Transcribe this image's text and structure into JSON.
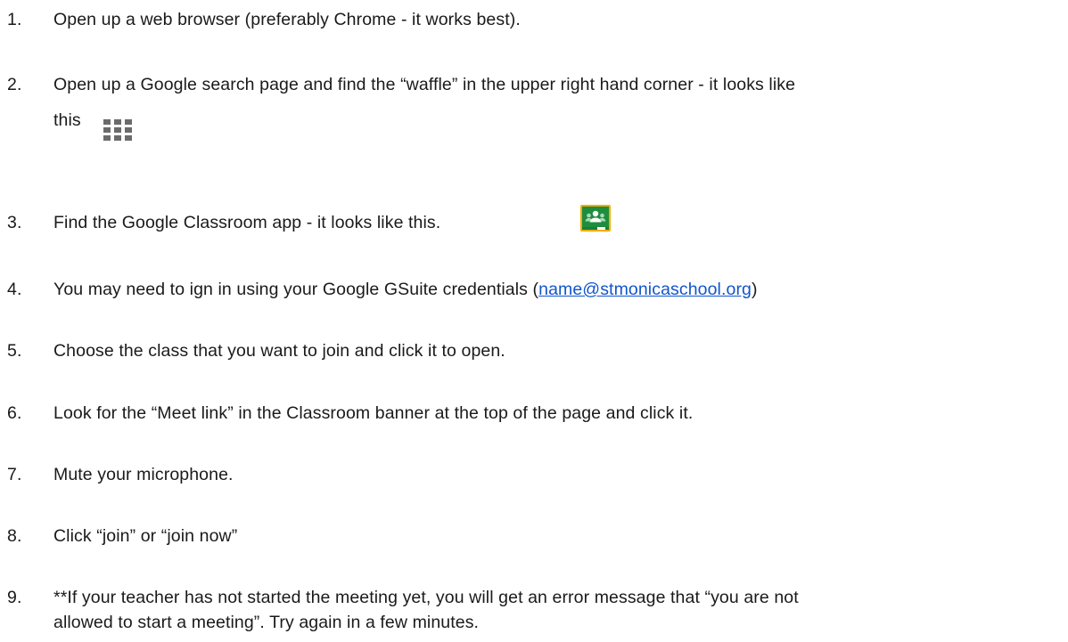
{
  "steps": [
    {
      "num": "1.",
      "text": "Open up a web browser (preferably  Chrome - it works best)."
    },
    {
      "num": "2.",
      "text": "Open up a Google search page and find the “waffle”  in the upper right hand corner - it looks like",
      "cont": "this"
    },
    {
      "num": "3.",
      "text": "Find the Google Classroom app - it looks like this."
    },
    {
      "num": "4.",
      "text_before": "You may need to ign in using your Google GSuite credentials (",
      "link": "name@stmonicaschool.org",
      "text_after": ")"
    },
    {
      "num": "5.",
      "text": "Choose the class that you want to join and click it to open."
    },
    {
      "num": "6.",
      "text": "Look for the “Meet link” in the Classroom banner at the top of the page and click it."
    },
    {
      "num": "7.",
      "text": "Mute your microphone."
    },
    {
      "num": "8.",
      "text": "Click “join” or “join now”"
    },
    {
      "num": "9.",
      "text": "**If your teacher has not started the meeting yet, you will get an error message that “you are not",
      "cont": "allowed to start a meeting”. Try again in a few minutes."
    }
  ],
  "icons": {
    "waffle": "apps-grid-icon",
    "classroom": "google-classroom-icon"
  },
  "colors": {
    "link": "#1155cc",
    "classroom_green": "#1e8e3e",
    "classroom_border": "#f9ab00"
  }
}
